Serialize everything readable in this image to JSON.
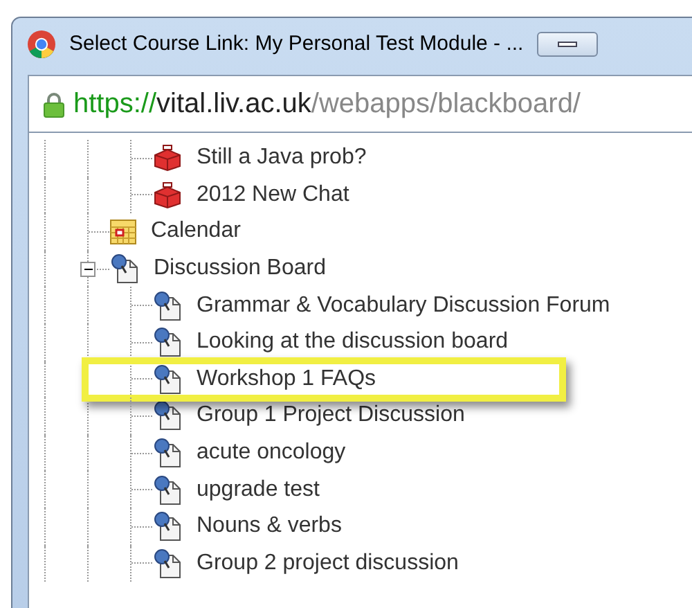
{
  "window": {
    "title": "Select Course Link: My Personal Test Module - ...",
    "url": {
      "scheme": "https://",
      "host": "vital.liv.ac.uk",
      "path": "/webapps/blackboard/"
    }
  },
  "tree": [
    {
      "children": [
        {
          "label": "Still a Java prob?",
          "kind": "chat"
        },
        {
          "label": "2012 New Chat",
          "kind": "chat"
        }
      ]
    },
    {
      "label": "Calendar",
      "kind": "calendar"
    },
    {
      "label": "Discussion Board",
      "kind": "forum",
      "expanded": true,
      "children": [
        {
          "label": "Grammar & Vocabulary Discussion Forum",
          "kind": "forum",
          "highlighted": false
        },
        {
          "label": "Looking at the discussion board",
          "kind": "forum",
          "highlighted": false
        },
        {
          "label": "Workshop 1 FAQs",
          "kind": "forum",
          "highlighted": true
        },
        {
          "label": "Group 1 Project Discussion",
          "kind": "forum",
          "highlighted": false
        },
        {
          "label": "acute oncology",
          "kind": "forum",
          "highlighted": false
        },
        {
          "label": "upgrade test",
          "kind": "forum",
          "highlighted": false
        },
        {
          "label": "Nouns & verbs",
          "kind": "forum",
          "highlighted": false
        },
        {
          "label": "Group 2 project discussion",
          "kind": "forum",
          "highlighted": false
        }
      ]
    }
  ]
}
